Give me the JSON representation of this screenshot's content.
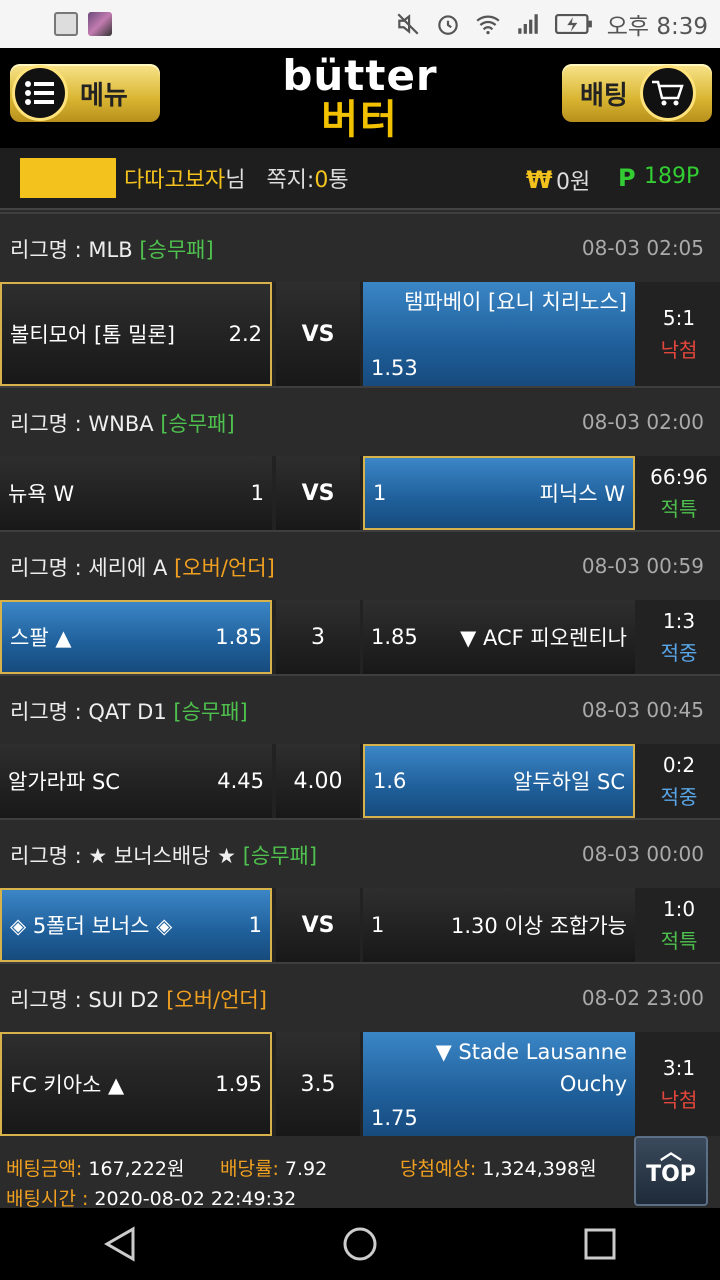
{
  "status": {
    "time": "오후 8:39"
  },
  "header": {
    "menu_label": "메뉴",
    "bet_label": "배팅",
    "logo_en": "bütter",
    "logo_ko": "버터"
  },
  "user": {
    "nick": "다따고보자",
    "suffix": "님",
    "msg_label": "쪽지:",
    "msg_count": "0",
    "msg_unit": "통",
    "won_symbol": "₩",
    "won": "0원",
    "point_symbol": "P",
    "point": "189P"
  },
  "matches": [
    {
      "league": "리그명 : MLB",
      "type": "[승무패]",
      "type_color": "green",
      "time": "08-03 02:05",
      "home": "볼티모어 [톰 밀론]",
      "home_odds": "2.2",
      "mid": "VS",
      "away": "탬파베이 [요니 치리노스]",
      "away_odds": "1.53",
      "score": "5:1",
      "status": "낙첨",
      "status_color": "red"
    },
    {
      "league": "리그명 : WNBA",
      "type": "[승무패]",
      "type_color": "green",
      "time": "08-03 02:00",
      "home": "뉴욕 W",
      "home_odds": "1",
      "mid": "VS",
      "away": "피닉스 W",
      "away_odds": "1",
      "score": "66:96",
      "status": "적특",
      "status_color": "green"
    },
    {
      "league": "리그명 : 세리에 A",
      "type": "[오버/언더]",
      "type_color": "orange",
      "time": "08-03 00:59",
      "home": "스팔 ▲",
      "home_odds": "1.85",
      "mid": "3",
      "away": "▼ ACF 피오렌티나",
      "away_odds": "1.85",
      "score": "1:3",
      "status": "적중",
      "status_color": "blue"
    },
    {
      "league": "리그명 : QAT D1",
      "type": "[승무패]",
      "type_color": "green",
      "time": "08-03 00:45",
      "home": "알가라파 SC",
      "home_odds": "4.45",
      "mid": "4.00",
      "away": "알두하일 SC",
      "away_odds": "1.6",
      "score": "0:2",
      "status": "적중",
      "status_color": "blue"
    },
    {
      "league": "리그명 : ★ 보너스배당 ★",
      "type": "[승무패]",
      "type_color": "green",
      "time": "08-03 00:00",
      "home": "◈ 5폴더 보너스 ◈",
      "home_odds": "1",
      "mid": "VS",
      "away": "1.30 이상 조합가능",
      "away_odds": "1",
      "score": "1:0",
      "status": "적특",
      "status_color": "green"
    },
    {
      "league": "리그명 : SUI D2",
      "type": "[오버/언더]",
      "type_color": "orange",
      "time": "08-02 23:00",
      "home": "FC 키아소 ▲",
      "home_odds": "1.95",
      "mid": "3.5",
      "away": "▼ Stade Lausanne Ouchy",
      "away_odds": "1.75",
      "score": "3:1",
      "status": "낙첨",
      "status_color": "red"
    }
  ],
  "summary": {
    "amount_label": "베팅금액:",
    "amount": "167,222원",
    "rate_label": "배당률:",
    "rate": "7.92",
    "expect_label": "당첨예상:",
    "expect": "1,324,398원",
    "time_label": "배팅시간 :",
    "time": "2020-08-02 22:49:32"
  },
  "top_button": "TOP"
}
